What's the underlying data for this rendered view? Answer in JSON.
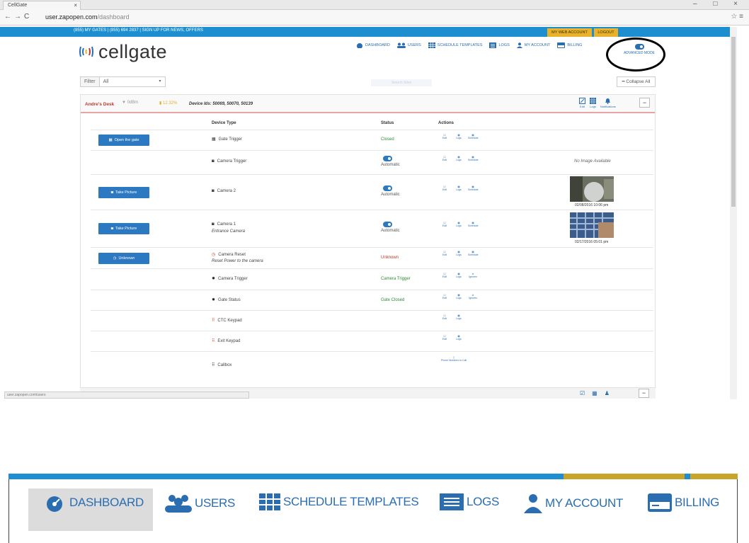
{
  "browser": {
    "tab_title": "CellGate",
    "tab_close": "×",
    "url_host": "user.zapopen.com",
    "url_path": "/dashboard",
    "window_controls": "–  □  ×",
    "status_url": "user.zapopen.com/users"
  },
  "topbar": {
    "info": "(855) MY GATES | (855) 694 2837 | SIGN UP FOR NEWS, OFFERS",
    "my_web_account": "MY WEB ACCOUNT",
    "logout": "LOGOUT"
  },
  "brand": {
    "name": "cellgate"
  },
  "nav": {
    "items": [
      {
        "label": "DASHBOARD",
        "icon": "dashboard-icon"
      },
      {
        "label": "USERS",
        "icon": "users-icon"
      },
      {
        "label": "SCHEDULE TEMPLATES",
        "icon": "schedule-icon"
      },
      {
        "label": "LOGS",
        "icon": "logs-icon"
      },
      {
        "label": "MY ACCOUNT",
        "icon": "account-icon"
      },
      {
        "label": "BILLING",
        "icon": "billing-icon"
      }
    ],
    "advanced_mode": "ADVANCED MODE"
  },
  "filter": {
    "label": "Filter",
    "value": "All",
    "search_placeholder": "Search Sites",
    "collapse_all": "Collapse All"
  },
  "panel": {
    "title": "Andre's Desk",
    "signal": "0dBm",
    "battery": "12.32%",
    "device_ids": "Device Ids: 50069, 50070, 50139",
    "actions": [
      "Edit",
      "Logs",
      "Notifications"
    ],
    "columns": {
      "device_type": "Device Type",
      "status": "Status",
      "actions": "Actions"
    },
    "rows": [
      {
        "button": "Open the gate",
        "device": "Gate Trigger",
        "status": "Closed",
        "actions": [
          "Edit",
          "Logs",
          "Schedule"
        ]
      },
      {
        "button": "",
        "device": "Camera Trigger",
        "status": "Automatic",
        "actions": [
          "Edit",
          "Logs",
          "Schedule"
        ],
        "note": "No Image Available"
      },
      {
        "button": "Take Picture",
        "device": "Camera 2",
        "status": "Automatic",
        "actions": [
          "Edit",
          "Logs",
          "Schedule"
        ],
        "caption": "02/08/2016 10:06 pm"
      },
      {
        "button": "Take Picture",
        "device": "Camera 1",
        "sub": "Entrance Camera",
        "status": "Automatic",
        "actions": [
          "Edit",
          "Logs",
          "Schedule"
        ],
        "caption": "02/17/2016 05:01 pm"
      },
      {
        "button": "Unknown",
        "device": "Camera Reset",
        "sub": "Reset Power to the camera",
        "status": "Unknown",
        "actions": [
          "Edit",
          "Logs",
          "Schedule"
        ]
      },
      {
        "button": "",
        "device": "Camera Trigger",
        "status": "Camera Trigger",
        "actions": [
          "Edit",
          "Logs",
          "Ignores"
        ]
      },
      {
        "button": "",
        "device": "Gate Status",
        "status": "Gate Closed",
        "actions": [
          "Edit",
          "Logs",
          "Ignores"
        ]
      },
      {
        "button": "",
        "device": "CTC Keypad",
        "status": "",
        "actions": [
          "Edit",
          "Logs"
        ]
      },
      {
        "button": "",
        "device": "Exit Keypad",
        "status": "",
        "actions": [
          "Edit",
          "Logs"
        ]
      },
      {
        "button": "",
        "device": "Callbox",
        "status": "",
        "actions": [
          "Phone Numbers to Call"
        ]
      }
    ]
  },
  "colors": {
    "brand_blue": "#1d8fd0",
    "accent_gold": "#e8b22b",
    "link_blue": "#2a6db0",
    "alert_red": "#c0392b",
    "ok_green": "#2e8b3a"
  }
}
